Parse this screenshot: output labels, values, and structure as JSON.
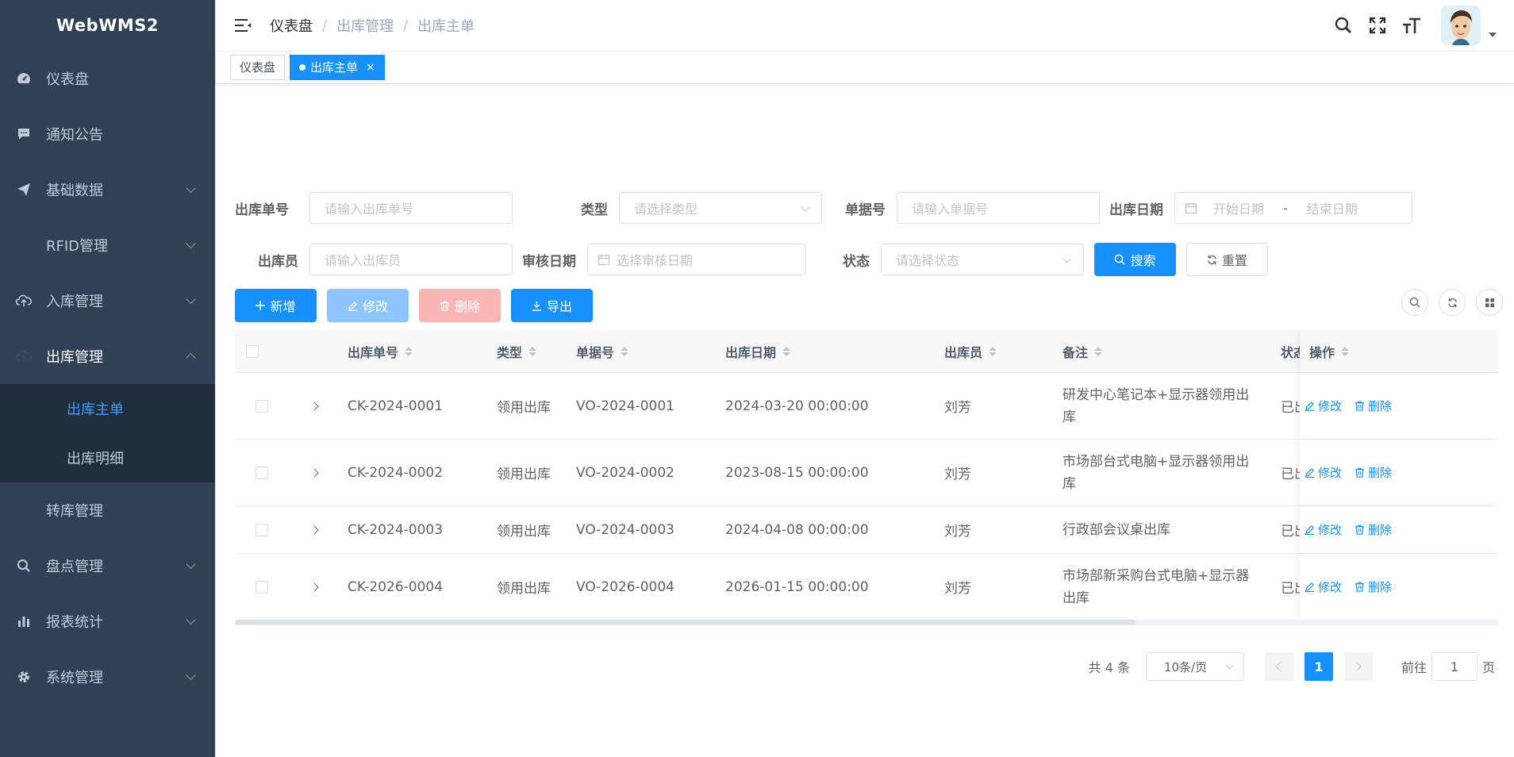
{
  "app": {
    "title": "WebWMS2"
  },
  "sidebar": {
    "items": [
      {
        "label": "仪表盘",
        "icon": "dashboard-icon"
      },
      {
        "label": "通知公告",
        "icon": "message-icon"
      },
      {
        "label": "基础数据",
        "icon": "send-icon"
      },
      {
        "label": "RFID管理",
        "icon": ""
      },
      {
        "label": "入库管理",
        "icon": "upload-icon"
      },
      {
        "label": "出库管理",
        "icon": "upload-icon"
      },
      {
        "label": "转库管理",
        "icon": ""
      },
      {
        "label": "盘点管理",
        "icon": "search-icon"
      },
      {
        "label": "报表统计",
        "icon": "chart-icon"
      },
      {
        "label": "系统管理",
        "icon": "gear-icon"
      }
    ],
    "submenu": [
      {
        "label": "出库主单"
      },
      {
        "label": "出库明细"
      }
    ]
  },
  "breadcrumb": [
    "仪表盘",
    "出库管理",
    "出库主单"
  ],
  "tags": [
    {
      "label": "仪表盘"
    },
    {
      "label": "出库主单",
      "close": "×"
    }
  ],
  "search": {
    "outbound_no": {
      "label": "出库单号",
      "placeholder": "请输入出库单号"
    },
    "type": {
      "label": "类型",
      "placeholder": "请选择类型"
    },
    "doc_no": {
      "label": "单据号",
      "placeholder": "请输入单据号"
    },
    "date": {
      "label": "出库日期",
      "start": "开始日期",
      "sep": "-",
      "end": "结束日期"
    },
    "operator": {
      "label": "出库员",
      "placeholder": "请输入出库员"
    },
    "audit_date": {
      "label": "审核日期",
      "placeholder": "选择审核日期"
    },
    "status": {
      "label": "状态",
      "placeholder": "请选择状态"
    },
    "search_btn": "搜索",
    "reset_btn": "重置"
  },
  "toolbar": {
    "add": "新增",
    "edit": "修改",
    "delete": "删除",
    "export": "导出"
  },
  "table": {
    "headers": {
      "no": "出库单号",
      "type": "类型",
      "doc": "单据号",
      "date": "出库日期",
      "op": "出库员",
      "remark": "备注",
      "status": "状态",
      "action": "操作"
    },
    "rows": [
      {
        "no": "CK-2024-0001",
        "type": "领用出库",
        "doc": "VO-2024-0001",
        "date": "2024-03-20 00:00:00",
        "op": "刘芳",
        "remark1": "研发中心笔记本+显示器领用出",
        "remark2": "库",
        "status": "已出",
        "edit": "修改",
        "del": "删除"
      },
      {
        "no": "CK-2024-0002",
        "type": "领用出库",
        "doc": "VO-2024-0002",
        "date": "2023-08-15 00:00:00",
        "op": "刘芳",
        "remark1": "市场部台式电脑+显示器领用出",
        "remark2": "库",
        "status": "已出",
        "edit": "修改",
        "del": "删除"
      },
      {
        "no": "CK-2024-0003",
        "type": "领用出库",
        "doc": "VO-2024-0003",
        "date": "2024-04-08 00:00:00",
        "op": "刘芳",
        "remark1": "行政部会议桌出库",
        "remark2": "",
        "status": "已出",
        "edit": "修改",
        "del": "删除"
      },
      {
        "no": "CK-2026-0004",
        "type": "领用出库",
        "doc": "VO-2026-0004",
        "date": "2026-01-15 00:00:00",
        "op": "刘芳",
        "remark1": "市场部新采购台式电脑+显示器",
        "remark2": "出库",
        "status": "已出",
        "edit": "修改",
        "del": "删除"
      }
    ]
  },
  "pager": {
    "total": "共 4 条",
    "size": "10条/页",
    "current": "1",
    "goto_pre": "前往",
    "goto_val": "1",
    "goto_post": "页"
  },
  "colors": {
    "primary": "#1890ff",
    "sidebar": "#304156",
    "submenu": "#1f2d3d"
  }
}
